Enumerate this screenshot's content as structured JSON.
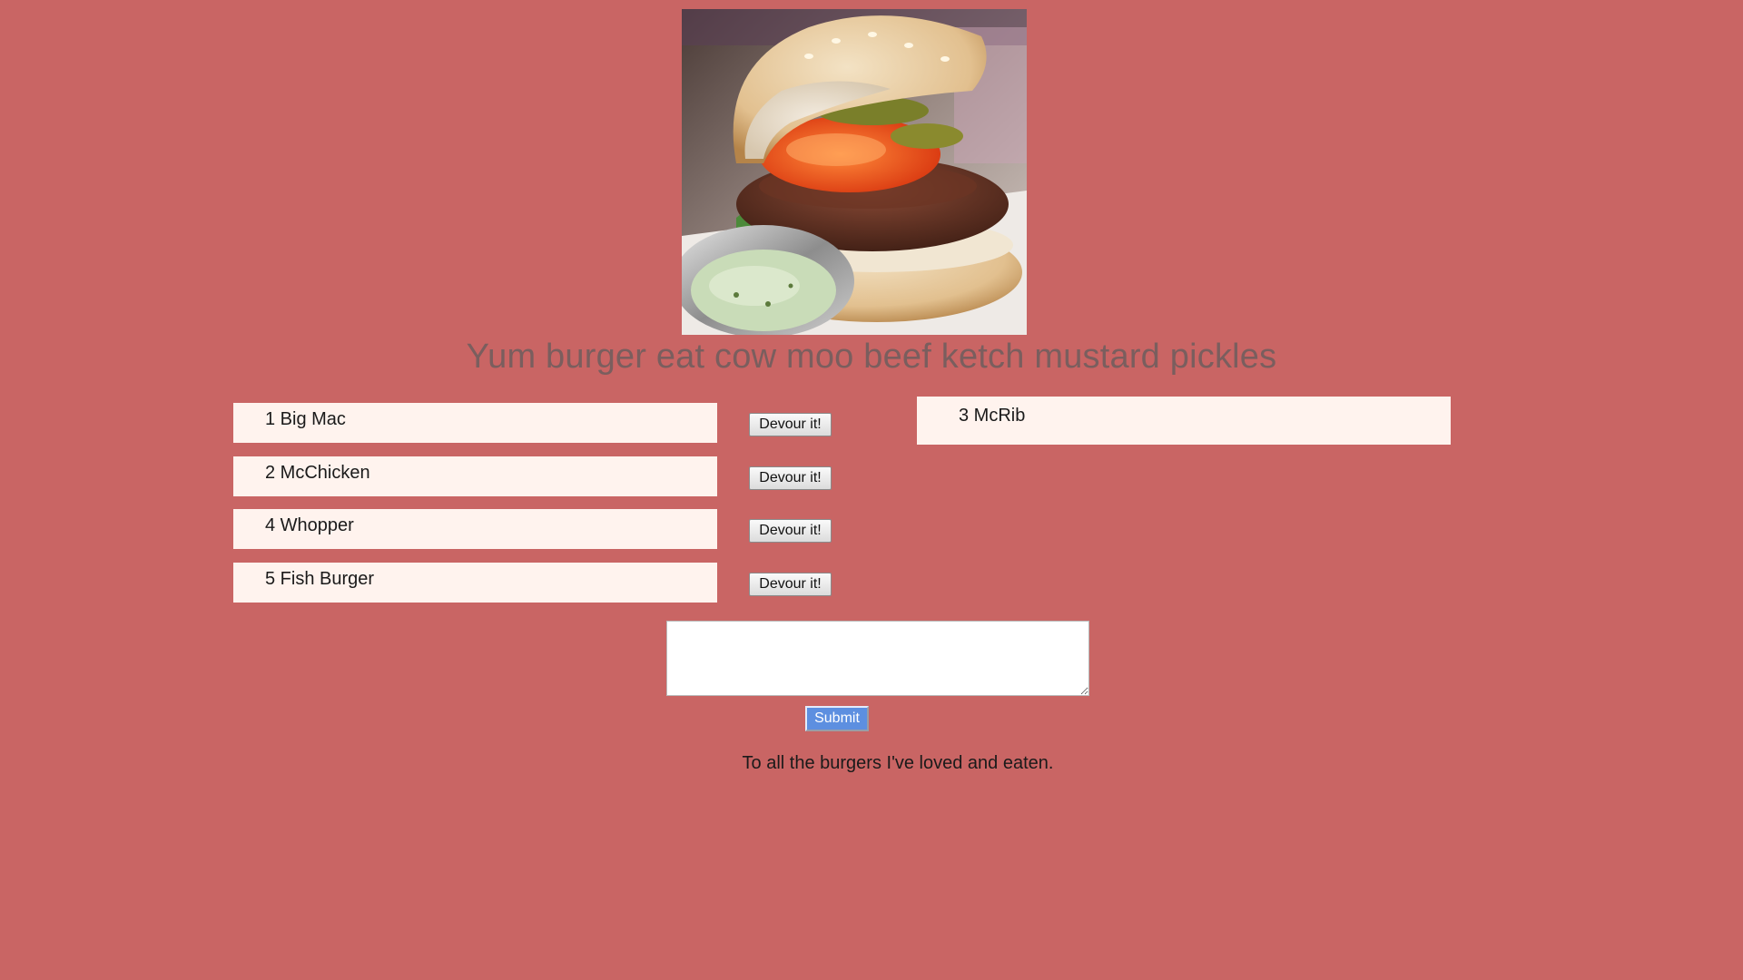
{
  "hero": {
    "image_subject": "burger-photo"
  },
  "headline": "Yum burger eat cow moo beef ketch mustard pickles",
  "burgers": [
    {
      "label": "1 Big Mac",
      "button_label": "Devour it!"
    },
    {
      "label": "2 McChicken",
      "button_label": "Devour it!"
    },
    {
      "label": "4 Whopper",
      "button_label": "Devour it!"
    },
    {
      "label": "5 Fish Burger",
      "button_label": "Devour it!"
    }
  ],
  "devoured": [
    {
      "label": "3 McRib"
    }
  ],
  "form": {
    "input_value": "",
    "submit_label": "Submit"
  },
  "footer": "To all the burgers I've loved and eaten.",
  "colors": {
    "background": "#c96564",
    "row_background": "#fff3ee",
    "headline": "#7a5e5e",
    "submit_button": "#5d8fe0"
  }
}
